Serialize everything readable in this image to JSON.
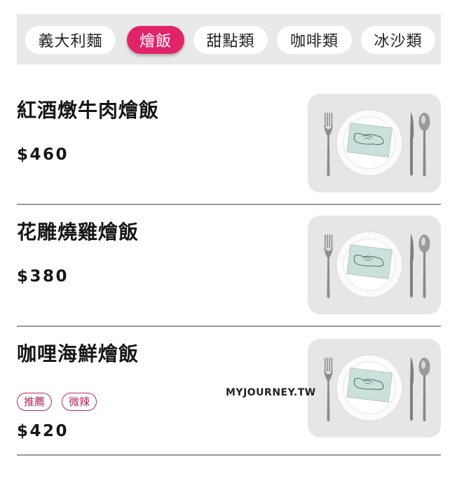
{
  "tabs": [
    {
      "label": "義大利麵",
      "active": false
    },
    {
      "label": "燴飯",
      "active": true
    },
    {
      "label": "甜點類",
      "active": false
    },
    {
      "label": "咖啡類",
      "active": false
    },
    {
      "label": "冰沙類",
      "active": false
    }
  ],
  "accent_color": "#e0246a",
  "tag_color": "#b32a55",
  "menu_items": [
    {
      "name": "紅酒燉牛肉燴飯",
      "price": "$460",
      "tags": [],
      "image_icon": "place-setting-icon"
    },
    {
      "name": "花雕燒雞燴飯",
      "price": "$380",
      "tags": [],
      "image_icon": "place-setting-icon"
    },
    {
      "name": "咖哩海鮮燴飯",
      "price": "$420",
      "tags": [
        "推薦",
        "微辣"
      ],
      "image_icon": "place-setting-icon"
    }
  ],
  "watermark": "MYJOURNEY.TW"
}
